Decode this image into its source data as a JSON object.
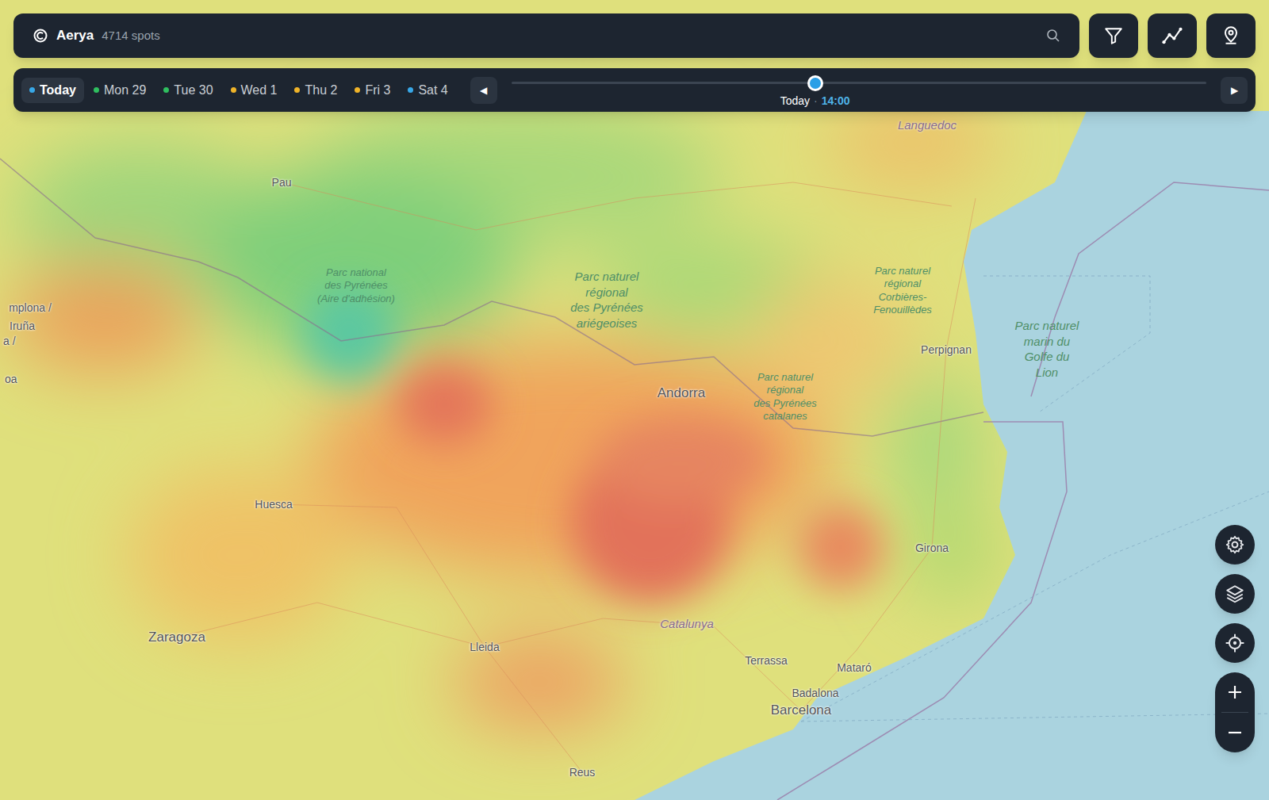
{
  "app": {
    "name": "Aerya",
    "spots": "4714 spots"
  },
  "days": [
    {
      "label": "Today",
      "selected": true,
      "color": "#38a8e8"
    },
    {
      "label": "Mon 29",
      "selected": false,
      "color": "#2fbf5f"
    },
    {
      "label": "Tue 30",
      "selected": false,
      "color": "#2fbf5f"
    },
    {
      "label": "Wed 1",
      "selected": false,
      "color": "#f0b429"
    },
    {
      "label": "Thu 2",
      "selected": false,
      "color": "#f0b429"
    },
    {
      "label": "Fri 3",
      "selected": false,
      "color": "#f0b429"
    },
    {
      "label": "Sat 4",
      "selected": false,
      "color": "#38a8e8"
    }
  ],
  "timeline": {
    "prev": "◀",
    "next": "▶",
    "level": 0.437,
    "day": "Today",
    "separator": "·",
    "time": "14:00"
  },
  "map_labels": [
    {
      "kind": "city",
      "lines": [
        "Pau"
      ]
    },
    {
      "kind": "city",
      "lines": [
        "mplona /"
      ]
    },
    {
      "kind": "city",
      "lines": [
        "Iruña"
      ]
    },
    {
      "kind": "city",
      "lines": [
        "a /"
      ]
    },
    {
      "kind": "city",
      "lines": [
        "oa"
      ]
    },
    {
      "kind": "city",
      "lines": [
        "Huesca"
      ]
    },
    {
      "kind": "capital",
      "lines": [
        "Zaragoza"
      ]
    },
    {
      "kind": "city",
      "lines": [
        "Lleida"
      ]
    },
    {
      "kind": "region",
      "lines": [
        "Catalunya"
      ]
    },
    {
      "kind": "city",
      "lines": [
        "Terrassa"
      ]
    },
    {
      "kind": "city",
      "lines": [
        "Mataró"
      ]
    },
    {
      "kind": "city",
      "lines": [
        "Badalona"
      ]
    },
    {
      "kind": "capital",
      "lines": [
        "Barcelona"
      ]
    },
    {
      "kind": "city",
      "lines": [
        "Reus"
      ]
    },
    {
      "kind": "city",
      "lines": [
        "Girona"
      ]
    },
    {
      "kind": "city",
      "lines": [
        "Perpignan"
      ]
    },
    {
      "kind": "capital",
      "lines": [
        "Andorra"
      ]
    },
    {
      "kind": "region",
      "lines": [
        "Languedoc"
      ]
    },
    {
      "kind": "park",
      "lines": [
        "Parc national",
        "des Pyrénées",
        "(Aire d'adhésion)"
      ]
    },
    {
      "kind": "bigpark",
      "lines": [
        "Parc naturel",
        "régional",
        "des Pyrénées",
        "ariégeoises"
      ]
    },
    {
      "kind": "park",
      "lines": [
        "Parc naturel",
        "régional",
        "Corbières-",
        "Fenouillèdes"
      ]
    },
    {
      "kind": "park",
      "lines": [
        "Parc naturel",
        "régional",
        "des Pyrénées",
        "catalanes"
      ]
    },
    {
      "kind": "bigpark",
      "lines": [
        "Parc naturel",
        "marin du",
        "Golfe du",
        "Lion"
      ]
    }
  ]
}
